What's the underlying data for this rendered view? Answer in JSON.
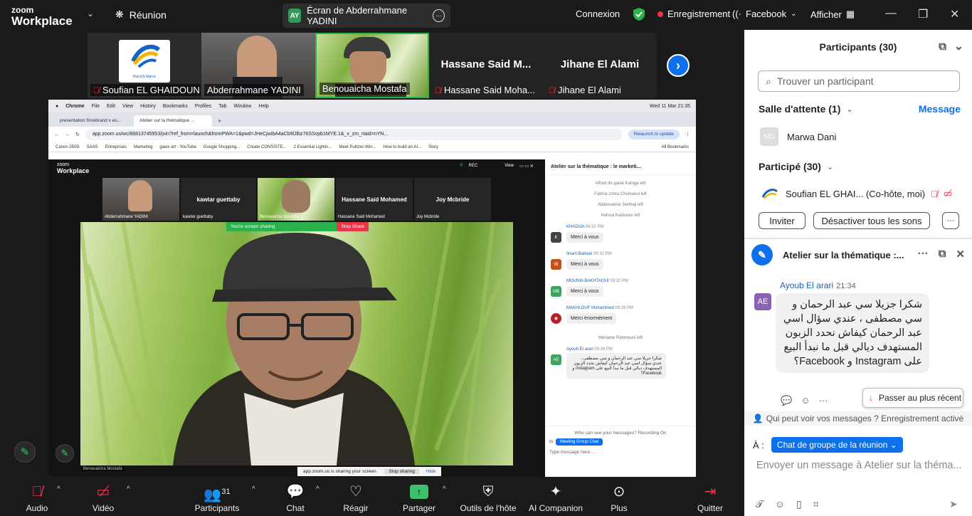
{
  "topbar": {
    "logo_line1": "zoom",
    "logo_line2": "Workplace",
    "meeting_label": "Réunion",
    "screen_badge": "AY",
    "screen_label": "Écran de Abderrahmane YADINI",
    "connexion": "Connexion",
    "recording": "Enregistrement",
    "facebook": "Facebook",
    "view": "Afficher"
  },
  "strip": {
    "participants": [
      {
        "name": "Soufian EL GHAIDOUNI",
        "muted": true,
        "logo_text": "Hub ES.Maroc"
      },
      {
        "name": "Abderrahmane YADINI",
        "muted": false
      },
      {
        "name": "Benouaicha Mostafa",
        "muted": false
      },
      {
        "name": "Hassane Said Moha...",
        "big": "Hassane  Said  M...",
        "muted": true
      },
      {
        "name": "Jihane El Alami",
        "big": "Jihane El Alami",
        "muted": true
      }
    ]
  },
  "share": {
    "mac_menu": [
      "Chrome",
      "File",
      "Edit",
      "View",
      "History",
      "Bookmarks",
      "Profiles",
      "Tab",
      "Window",
      "Help"
    ],
    "mac_clock": "Wed 11 Mar  21:35",
    "tabs": [
      "presentation finrebrand x es...",
      "Atelier sur la thématique ..."
    ],
    "url": "app.zoom.us/wc/86813745953/join?ref_from=launch&fromPWA=1&pwd=JHeCjwibA4aCb9lJlbz76SSvpb1MYE.1&_x_zm_rtaid=nYN...",
    "relaunch": "Relaunch to update",
    "bookmarks": [
      "Canon 250D",
      "SAAS",
      "Entreprises",
      "Marketing",
      "gawx art - YouTube",
      "Google Shopping...",
      "Create CONSISTE...",
      "2 Essential Lightin...",
      "Meet Pulitzer-Win...",
      "How to build an AI...",
      "Story",
      "All Bookmarks"
    ],
    "inner_logo1": "zoom",
    "inner_logo2": "Workplace",
    "inner_view": "View",
    "inner_rec": "REC",
    "inner_thumbs": [
      {
        "name": "Abderrahmane YADINI"
      },
      {
        "name": "kawtar guettaby",
        "big": "kawtar guettaby"
      },
      {
        "name": "Benouaicha Mostafa"
      },
      {
        "name": "Hassane Said Mohamed",
        "big": "Hassane Said Mohamed"
      },
      {
        "name": "Joy Mcbride",
        "big": "Joy Mcbride"
      }
    ],
    "sharing_text": "You're screen sharing",
    "stop_share": "Stop Share",
    "video_name": "Benouaicha Mostafa",
    "share_notice": "app.zoom.us is sharing your screen.",
    "stop_sharing": "Stop sharing",
    "hide": "Hide",
    "inner_chat": {
      "title": "Atelier sur la thématique : le marketi...",
      "left_notes": [
        "Alfred de gaule Kamga left",
        "Fatima zohra Cherkaoui left",
        "Abdessamie Senhaji left",
        "Hafssa Kasbaoui left"
      ],
      "messages": [
        {
          "av": "K",
          "color": "#444",
          "name": "KHADIJA",
          "time": "09:32 PM",
          "text": "Merci à vous"
        },
        {
          "av": "IB",
          "color": "#c0521d",
          "name": "Ikram Ballouk",
          "time": "09:32 PM",
          "text": "Merci à vous"
        },
        {
          "av": "MB",
          "color": "#3ea35c",
          "name": "MOUNIA BAKHTAOUI",
          "time": "09:32 PM",
          "text": "Merci à vous"
        },
        {
          "av": "◉",
          "color": "#b3202a",
          "name": "MAKHLOUF Mohammed",
          "time": "09:33 PM",
          "text": "Merci énormément"
        }
      ],
      "left_note2": "Meriame Rahmouni left",
      "last_name": "Ayoub El arari",
      "last_time": "09:34 PM",
      "last_text": "شكرا جزيلا سي عبد الرحمان و سي مصطفى ، عندي سؤال اسي عبد الرحمان كيفاش نحدد الزبون المستهدف ديالي قبل ما نبدأ البيع على Instagram و Facebook؟",
      "who": "Who can see your messages? Recording On",
      "to": "to:",
      "chip": "Meeting Group Chat",
      "placeholder": "Type message here ..."
    }
  },
  "panel": {
    "title": "Participants (30)",
    "search_placeholder": "Trouver un participant",
    "waiting": "Salle d'attente (1)",
    "message_link": "Message",
    "waiting_person": {
      "initials": "MD",
      "name": "Marwa Dani"
    },
    "joined": "Participé (30)",
    "host": "Soufian EL GHAI... (Co-hôte, moi)",
    "invite": "Inviter",
    "mute_all": "Désactiver tous les sons",
    "more": "···"
  },
  "chat": {
    "title": "Atelier sur la thématique :...",
    "sender": "Ayoub El arari",
    "time": "21:34",
    "avatar": "AE",
    "message": "شكرا جزيلا سي عبد الرحمان و سي مصطفى ، عندي سؤال اسي عبد الرحمان كيفاش نحدد الزبون المستهدف ديالي قبل ما نبدأ البيع على Instagram و Facebook؟",
    "jump": "Passer au plus récent",
    "who_sees": "Qui peut voir vos messages ? Enregistrement activé",
    "to_label": "À :",
    "to_chip": "Chat de groupe de la réunion",
    "input_placeholder": "Envoyer un message à Atelier sur la théma..."
  },
  "toolbar": {
    "audio": "Audio",
    "video": "Vidéo",
    "participants": "Participants",
    "participants_count": "31",
    "chat": "Chat",
    "react": "Réagir",
    "share": "Partager",
    "host_tools": "Outils de l'hôte",
    "ai": "AI Companion",
    "more": "Plus",
    "quit": "Quitter"
  },
  "colors": {
    "accent": "#0e71eb",
    "share_green": "#3ec06a",
    "alert_red": "#e8364a"
  }
}
